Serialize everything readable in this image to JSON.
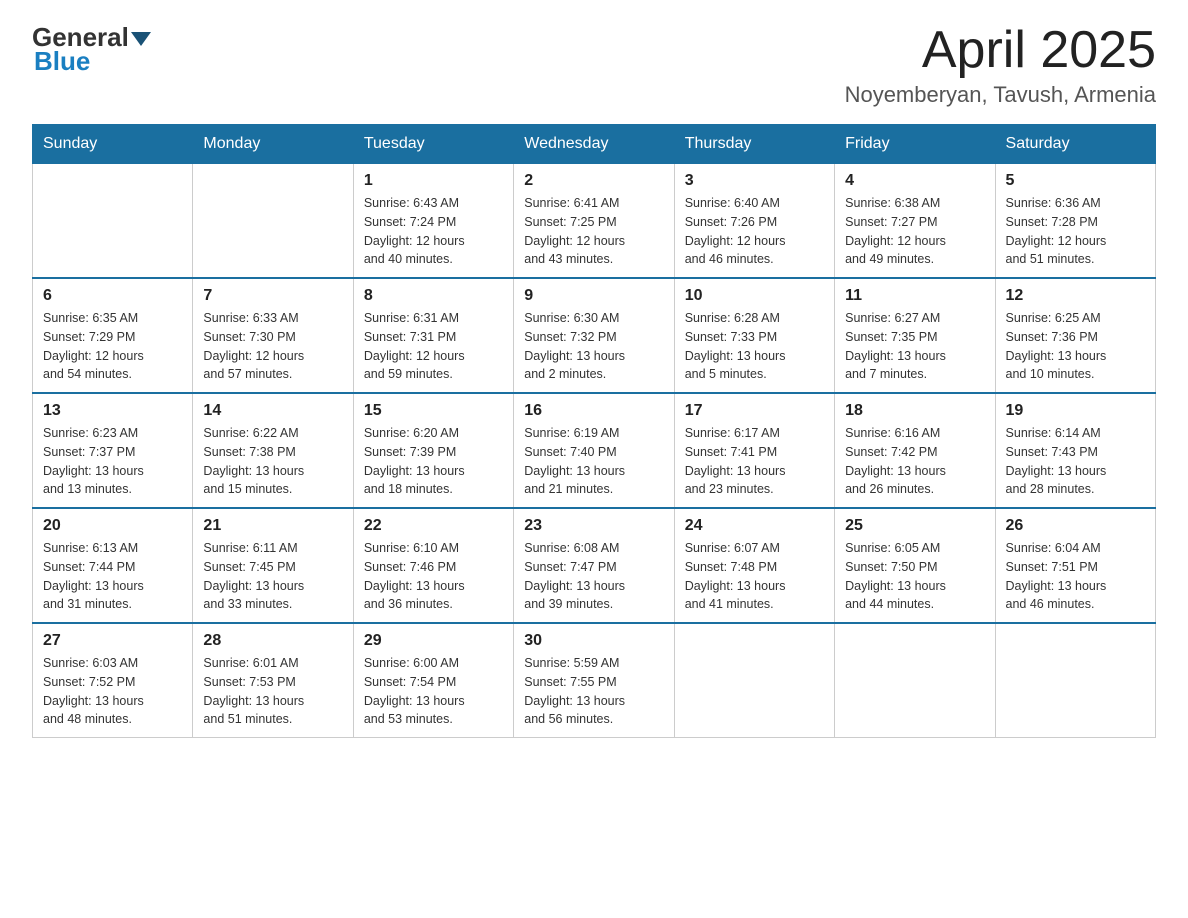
{
  "logo": {
    "general": "General",
    "blue": "Blue"
  },
  "title": "April 2025",
  "subtitle": "Noyemberyan, Tavush, Armenia",
  "days_of_week": [
    "Sunday",
    "Monday",
    "Tuesday",
    "Wednesday",
    "Thursday",
    "Friday",
    "Saturday"
  ],
  "weeks": [
    [
      {
        "day": "",
        "info": ""
      },
      {
        "day": "",
        "info": ""
      },
      {
        "day": "1",
        "info": "Sunrise: 6:43 AM\nSunset: 7:24 PM\nDaylight: 12 hours\nand 40 minutes."
      },
      {
        "day": "2",
        "info": "Sunrise: 6:41 AM\nSunset: 7:25 PM\nDaylight: 12 hours\nand 43 minutes."
      },
      {
        "day": "3",
        "info": "Sunrise: 6:40 AM\nSunset: 7:26 PM\nDaylight: 12 hours\nand 46 minutes."
      },
      {
        "day": "4",
        "info": "Sunrise: 6:38 AM\nSunset: 7:27 PM\nDaylight: 12 hours\nand 49 minutes."
      },
      {
        "day": "5",
        "info": "Sunrise: 6:36 AM\nSunset: 7:28 PM\nDaylight: 12 hours\nand 51 minutes."
      }
    ],
    [
      {
        "day": "6",
        "info": "Sunrise: 6:35 AM\nSunset: 7:29 PM\nDaylight: 12 hours\nand 54 minutes."
      },
      {
        "day": "7",
        "info": "Sunrise: 6:33 AM\nSunset: 7:30 PM\nDaylight: 12 hours\nand 57 minutes."
      },
      {
        "day": "8",
        "info": "Sunrise: 6:31 AM\nSunset: 7:31 PM\nDaylight: 12 hours\nand 59 minutes."
      },
      {
        "day": "9",
        "info": "Sunrise: 6:30 AM\nSunset: 7:32 PM\nDaylight: 13 hours\nand 2 minutes."
      },
      {
        "day": "10",
        "info": "Sunrise: 6:28 AM\nSunset: 7:33 PM\nDaylight: 13 hours\nand 5 minutes."
      },
      {
        "day": "11",
        "info": "Sunrise: 6:27 AM\nSunset: 7:35 PM\nDaylight: 13 hours\nand 7 minutes."
      },
      {
        "day": "12",
        "info": "Sunrise: 6:25 AM\nSunset: 7:36 PM\nDaylight: 13 hours\nand 10 minutes."
      }
    ],
    [
      {
        "day": "13",
        "info": "Sunrise: 6:23 AM\nSunset: 7:37 PM\nDaylight: 13 hours\nand 13 minutes."
      },
      {
        "day": "14",
        "info": "Sunrise: 6:22 AM\nSunset: 7:38 PM\nDaylight: 13 hours\nand 15 minutes."
      },
      {
        "day": "15",
        "info": "Sunrise: 6:20 AM\nSunset: 7:39 PM\nDaylight: 13 hours\nand 18 minutes."
      },
      {
        "day": "16",
        "info": "Sunrise: 6:19 AM\nSunset: 7:40 PM\nDaylight: 13 hours\nand 21 minutes."
      },
      {
        "day": "17",
        "info": "Sunrise: 6:17 AM\nSunset: 7:41 PM\nDaylight: 13 hours\nand 23 minutes."
      },
      {
        "day": "18",
        "info": "Sunrise: 6:16 AM\nSunset: 7:42 PM\nDaylight: 13 hours\nand 26 minutes."
      },
      {
        "day": "19",
        "info": "Sunrise: 6:14 AM\nSunset: 7:43 PM\nDaylight: 13 hours\nand 28 minutes."
      }
    ],
    [
      {
        "day": "20",
        "info": "Sunrise: 6:13 AM\nSunset: 7:44 PM\nDaylight: 13 hours\nand 31 minutes."
      },
      {
        "day": "21",
        "info": "Sunrise: 6:11 AM\nSunset: 7:45 PM\nDaylight: 13 hours\nand 33 minutes."
      },
      {
        "day": "22",
        "info": "Sunrise: 6:10 AM\nSunset: 7:46 PM\nDaylight: 13 hours\nand 36 minutes."
      },
      {
        "day": "23",
        "info": "Sunrise: 6:08 AM\nSunset: 7:47 PM\nDaylight: 13 hours\nand 39 minutes."
      },
      {
        "day": "24",
        "info": "Sunrise: 6:07 AM\nSunset: 7:48 PM\nDaylight: 13 hours\nand 41 minutes."
      },
      {
        "day": "25",
        "info": "Sunrise: 6:05 AM\nSunset: 7:50 PM\nDaylight: 13 hours\nand 44 minutes."
      },
      {
        "day": "26",
        "info": "Sunrise: 6:04 AM\nSunset: 7:51 PM\nDaylight: 13 hours\nand 46 minutes."
      }
    ],
    [
      {
        "day": "27",
        "info": "Sunrise: 6:03 AM\nSunset: 7:52 PM\nDaylight: 13 hours\nand 48 minutes."
      },
      {
        "day": "28",
        "info": "Sunrise: 6:01 AM\nSunset: 7:53 PM\nDaylight: 13 hours\nand 51 minutes."
      },
      {
        "day": "29",
        "info": "Sunrise: 6:00 AM\nSunset: 7:54 PM\nDaylight: 13 hours\nand 53 minutes."
      },
      {
        "day": "30",
        "info": "Sunrise: 5:59 AM\nSunset: 7:55 PM\nDaylight: 13 hours\nand 56 minutes."
      },
      {
        "day": "",
        "info": ""
      },
      {
        "day": "",
        "info": ""
      },
      {
        "day": "",
        "info": ""
      }
    ]
  ]
}
